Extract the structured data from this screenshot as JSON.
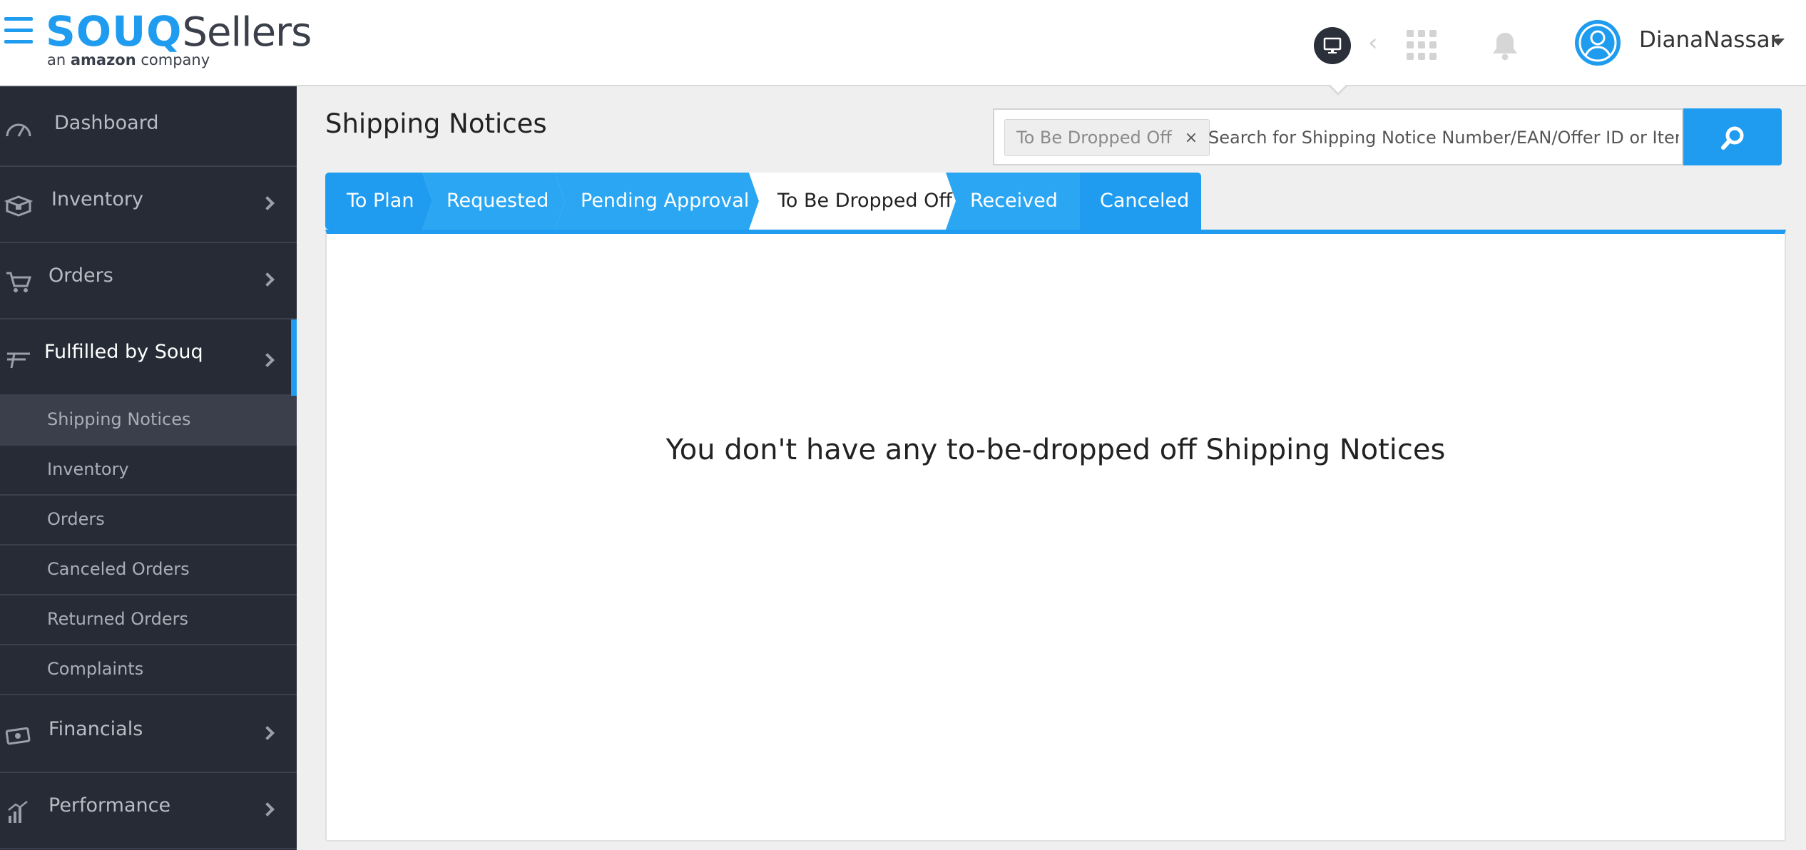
{
  "header": {
    "logo_brand": "SOUQ",
    "logo_product": "Sellers",
    "logo_tagline_prefix": "an ",
    "logo_tagline_brand": "amazon",
    "logo_tagline_suffix": " company",
    "user_name": "DianaNassar"
  },
  "sidebar": {
    "items": [
      {
        "label": "Dashboard",
        "icon": "gauge-icon"
      },
      {
        "label": "Inventory",
        "icon": "box-icon"
      },
      {
        "label": "Orders",
        "icon": "cart-icon"
      },
      {
        "label": "Fulfilled by Souq",
        "icon": "fulfilled-icon"
      },
      {
        "label": "Financials",
        "icon": "money-icon"
      },
      {
        "label": "Performance",
        "icon": "bar-chart-icon"
      }
    ],
    "sub_items": [
      {
        "label": "Shipping Notices"
      },
      {
        "label": "Inventory"
      },
      {
        "label": "Orders"
      },
      {
        "label": "Canceled Orders"
      },
      {
        "label": "Returned Orders"
      },
      {
        "label": "Complaints"
      }
    ]
  },
  "main": {
    "title": "Shipping Notices",
    "search": {
      "chip_label": "To Be Dropped Off",
      "chip_remove": "×",
      "placeholder": "Search for Shipping Notice Number/EAN/Offer ID or Item Title"
    },
    "tabs": [
      {
        "label": "To Plan"
      },
      {
        "label": "Requested"
      },
      {
        "label": "Pending Approval"
      },
      {
        "label": "To Be Dropped Off"
      },
      {
        "label": "Received"
      },
      {
        "label": "Canceled"
      }
    ],
    "empty_message": "You don't have any to-be-dropped off Shipping Notices"
  },
  "colors": {
    "accent": "#1f9cf0",
    "sidebar_bg": "#262b36",
    "page_bg": "#efefef"
  }
}
